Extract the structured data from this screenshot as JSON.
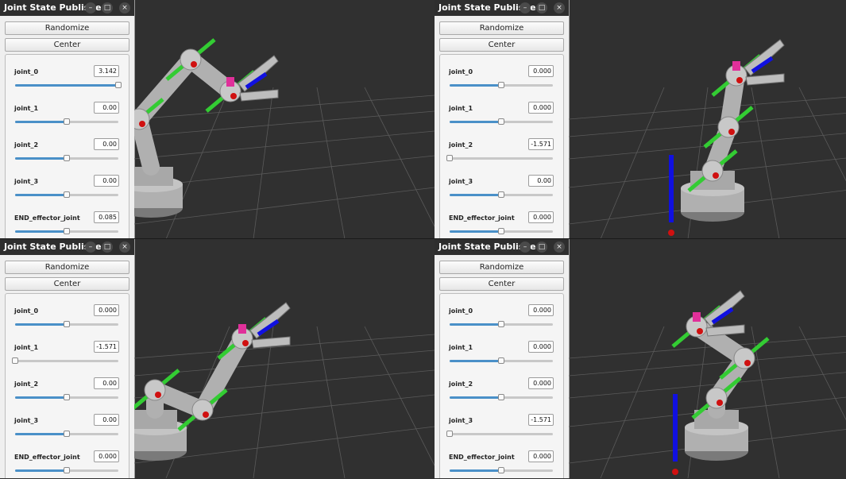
{
  "windows": [
    {
      "title": "Joint State Publisher",
      "minimize_glyph": "–",
      "maximize_glyph": "□",
      "close_glyph": "×",
      "randomize_label": "Randomize",
      "center_label": "Center",
      "joints": [
        {
          "name": "joint_0",
          "value": "3.142",
          "level": 1.0
        },
        {
          "name": "joint_1",
          "value": "0.00",
          "level": 0.5
        },
        {
          "name": "joint_2",
          "value": "0.00",
          "level": 0.5
        },
        {
          "name": "joint_3",
          "value": "0.00",
          "level": 0.5
        },
        {
          "name": "END_effector_joint",
          "value": "0.085",
          "level": 0.5
        }
      ]
    },
    {
      "title": "Joint State Publisher",
      "minimize_glyph": "–",
      "maximize_glyph": "□",
      "close_glyph": "×",
      "randomize_label": "Randomize",
      "center_label": "Center",
      "joints": [
        {
          "name": "joint_0",
          "value": "0.000",
          "level": 0.5
        },
        {
          "name": "joint_1",
          "value": "0.000",
          "level": 0.5
        },
        {
          "name": "joint_2",
          "value": "-1.571",
          "level": 0.0
        },
        {
          "name": "joint_3",
          "value": "0.00",
          "level": 0.5
        },
        {
          "name": "END_effector_joint",
          "value": "0.000",
          "level": 0.5
        }
      ]
    },
    {
      "title": "Joint State Publisher",
      "minimize_glyph": "–",
      "maximize_glyph": "□",
      "close_glyph": "×",
      "randomize_label": "Randomize",
      "center_label": "Center",
      "joints": [
        {
          "name": "joint_0",
          "value": "0.000",
          "level": 0.5
        },
        {
          "name": "joint_1",
          "value": "-1.571",
          "level": 0.0
        },
        {
          "name": "joint_2",
          "value": "0.00",
          "level": 0.5
        },
        {
          "name": "joint_3",
          "value": "0.00",
          "level": 0.5
        },
        {
          "name": "END_effector_joint",
          "value": "0.000",
          "level": 0.5
        }
      ]
    },
    {
      "title": "Joint State Publisher",
      "minimize_glyph": "–",
      "maximize_glyph": "□",
      "close_glyph": "×",
      "randomize_label": "Randomize",
      "center_label": "Center",
      "joints": [
        {
          "name": "joint_0",
          "value": "0.000",
          "level": 0.5
        },
        {
          "name": "joint_1",
          "value": "0.000",
          "level": 0.5
        },
        {
          "name": "joint_2",
          "value": "0.000",
          "level": 0.5
        },
        {
          "name": "joint_3",
          "value": "-1.571",
          "level": 0.0
        },
        {
          "name": "END_effector_joint",
          "value": "0.000",
          "level": 0.5
        }
      ]
    }
  ],
  "colors": {
    "viewport_background": "#303030",
    "grid": "#5a5a5a",
    "robot_body": "#b0b0b0",
    "robot_shadow": "#7a7a7a",
    "axis_x": "#d01010",
    "axis_y": "#33cc33",
    "axis_z": "#1010e0",
    "joint_accent": "#e0309a",
    "slider_fill": "#4a90c8",
    "titlebar": "#2e2e2e"
  }
}
